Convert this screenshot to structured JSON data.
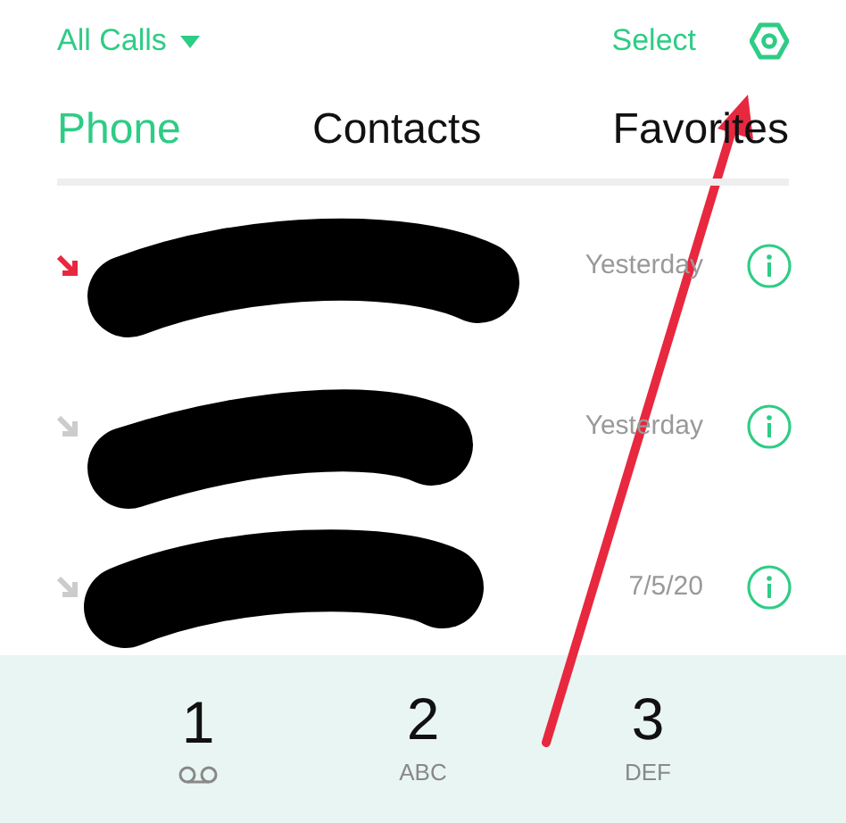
{
  "header": {
    "filter": "All Calls",
    "select": "Select"
  },
  "tabs": [
    {
      "label": "Phone",
      "selected": true
    },
    {
      "label": "Contacts",
      "selected": false
    },
    {
      "label": "Favorites",
      "selected": false
    }
  ],
  "calls": [
    {
      "kind": "missed",
      "time": "Yesterday"
    },
    {
      "kind": "incoming",
      "time": "Yesterday"
    },
    {
      "kind": "incoming",
      "time": "7/5/20"
    }
  ],
  "keypad": [
    {
      "digit": "1",
      "kind": "voicemail"
    },
    {
      "digit": "2",
      "letters": "ABC",
      "kind": "letters"
    },
    {
      "digit": "3",
      "letters": "DEF",
      "kind": "letters"
    }
  ]
}
